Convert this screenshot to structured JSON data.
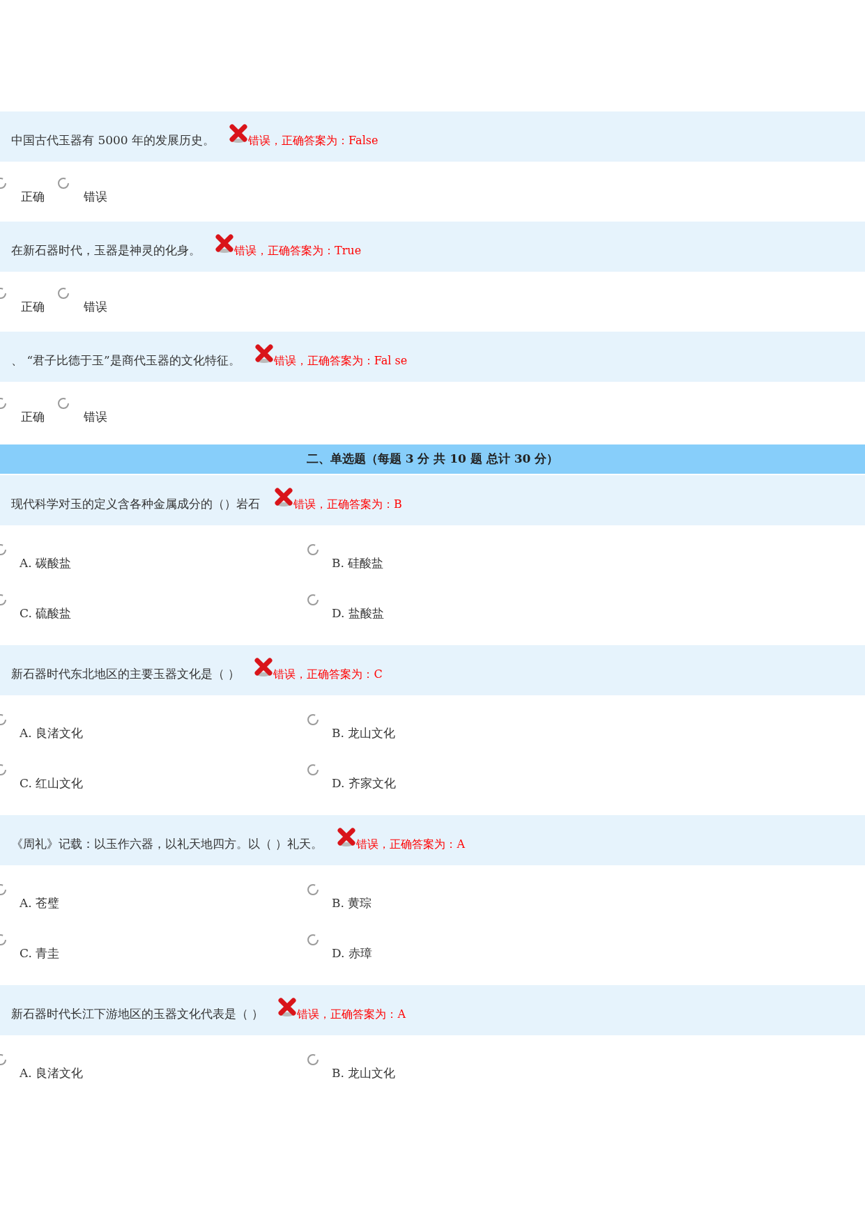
{
  "true_false": [
    {
      "question": "中国古代玉器有 5000 年的发展历史。",
      "correct": false,
      "feedback": "错误，正确答案为：False",
      "options": [
        {
          "label": "正确",
          "selected": false
        },
        {
          "label": "错误",
          "selected": false
        }
      ]
    },
    {
      "question": "在新石器时代，玉器是神灵的化身。",
      "correct": false,
      "feedback": "错误，正确答案为：True",
      "options": [
        {
          "label": "正确",
          "selected": false
        },
        {
          "label": "错误",
          "selected": false
        }
      ]
    },
    {
      "question": "、 “君子比德于玉”是商代玉器的文化特征。",
      "correct": false,
      "feedback": "错误，正确答案为：Fal se",
      "options": [
        {
          "label": "正确",
          "selected": false
        },
        {
          "label": "错误",
          "selected": false
        }
      ]
    }
  ],
  "section_header": "二、单选题（每题 3 分 共 10 题 总计 30 分）",
  "single_choice": [
    {
      "question": "现代科学对玉的定义含各种金属成分的（）岩石",
      "correct": false,
      "feedback": "错误，正确答案为：B",
      "options": [
        {
          "label": "A. 碳酸盐",
          "selected": false
        },
        {
          "label": "B. 硅酸盐",
          "selected": false
        },
        {
          "label": "C. 硫酸盐",
          "selected": false
        },
        {
          "label": "D. 盐酸盐",
          "selected": false
        }
      ]
    },
    {
      "question": "新石器时代东北地区的主要玉器文化是（ ）",
      "correct": false,
      "feedback": "错误，正确答案为：C",
      "options": [
        {
          "label": "A. 良渚文化",
          "selected": false
        },
        {
          "label": "B. 龙山文化",
          "selected": false
        },
        {
          "label": "C. 红山文化",
          "selected": false
        },
        {
          "label": "D. 齐家文化",
          "selected": false
        }
      ]
    },
    {
      "question": "《周礼》记载：以玉作六器，以礼天地四方。以（ ）礼天。",
      "correct": false,
      "feedback": "错误，正确答案为：A",
      "options": [
        {
          "label": "A. 苍璧",
          "selected": false
        },
        {
          "label": "B. 黄琮",
          "selected": false
        },
        {
          "label": "C. 青圭",
          "selected": false
        },
        {
          "label": "D. 赤璋",
          "selected": false
        }
      ]
    },
    {
      "question": "新石器时代长江下游地区的玉器文化代表是（ ）",
      "correct": false,
      "feedback": "错误，正确答案为：A",
      "options": [
        {
          "label": "A. 良渚文化",
          "selected": false
        },
        {
          "label": "B. 龙山文化",
          "selected": false
        }
      ]
    }
  ]
}
